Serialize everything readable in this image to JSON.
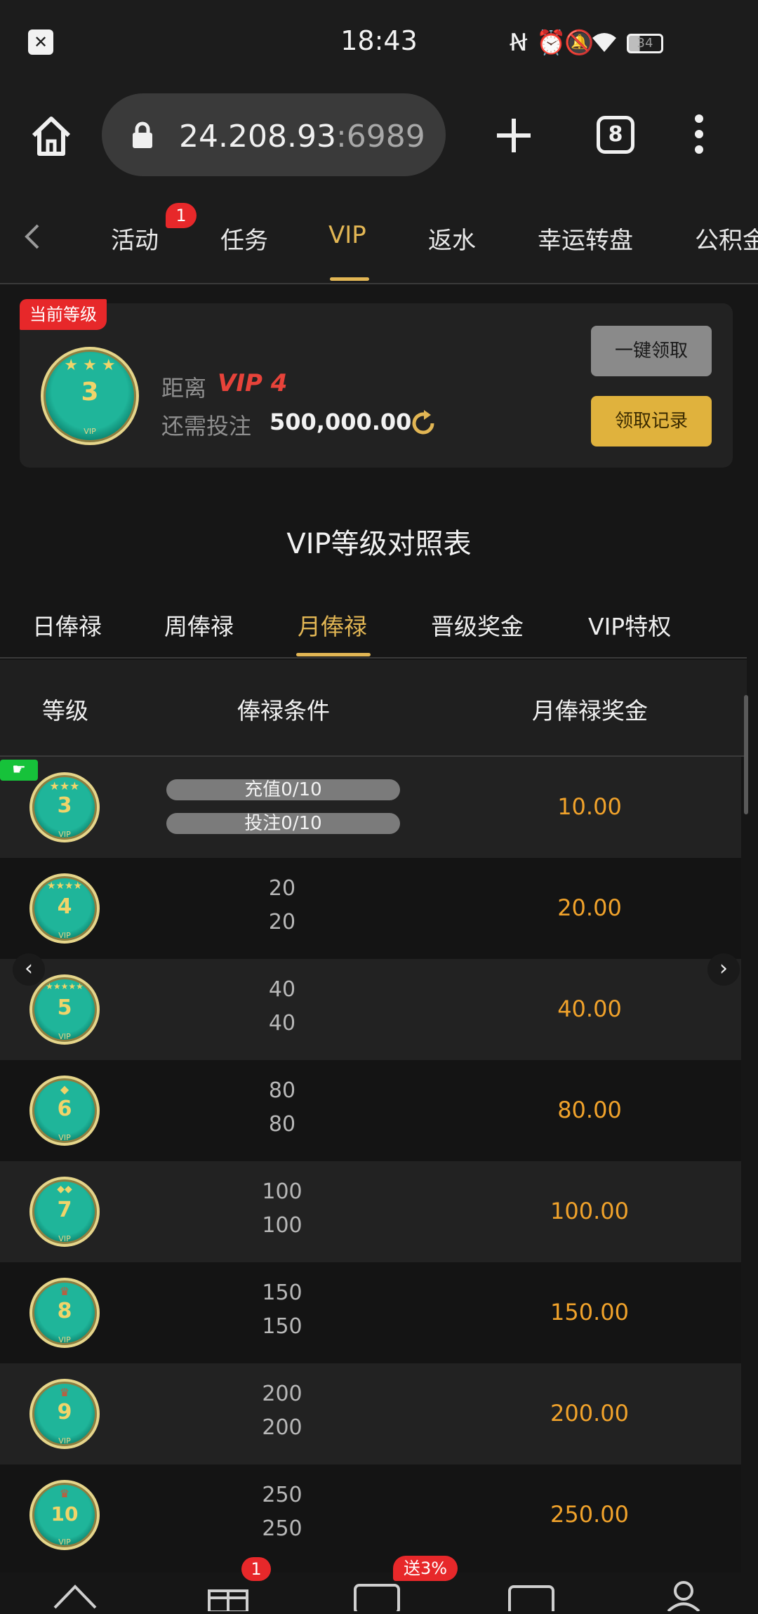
{
  "status_bar": {
    "time": "18:43",
    "battery": "34",
    "icons": [
      "notification-icon",
      "nfc-icon",
      "alarm-icon",
      "mute-icon",
      "wifi-icon",
      "battery-icon"
    ]
  },
  "browser": {
    "url_main": "24.208.93",
    "url_port": ":6989",
    "tab_count": "8"
  },
  "nav_tabs": [
    {
      "label": "活动"
    },
    {
      "label": "任务"
    },
    {
      "label": "VIP"
    },
    {
      "label": "返水"
    },
    {
      "label": "幸运转盘"
    },
    {
      "label": "公积金"
    }
  ],
  "nav_badge": "1",
  "level_card": {
    "tag": "当前等级",
    "current_level": "3",
    "distance_label": "距离",
    "next_vip": "VIP 4",
    "bet_label": "还需投注",
    "bet_amount": "500,000.00",
    "claim_all_label": "一键领取",
    "claim_record_label": "领取记录"
  },
  "table_title": "VIP等级对照表",
  "sub_tabs": [
    {
      "label": "日俸禄"
    },
    {
      "label": "周俸禄"
    },
    {
      "label": "月俸禄"
    },
    {
      "label": "晋级奖金"
    },
    {
      "label": "VIP特权"
    }
  ],
  "table": {
    "headers": {
      "level": "等级",
      "condition": "俸禄条件",
      "bonus": "月俸禄奖金"
    },
    "rows": [
      {
        "level": "3",
        "cond1": "充值0/10",
        "cond2": "投注0/10",
        "bonus": "10.00"
      },
      {
        "level": "4",
        "cond1": "20",
        "cond2": "20",
        "bonus": "20.00"
      },
      {
        "level": "5",
        "cond1": "40",
        "cond2": "40",
        "bonus": "40.00"
      },
      {
        "level": "6",
        "cond1": "80",
        "cond2": "80",
        "bonus": "80.00"
      },
      {
        "level": "7",
        "cond1": "100",
        "cond2": "100",
        "bonus": "100.00"
      },
      {
        "level": "8",
        "cond1": "150",
        "cond2": "150",
        "bonus": "150.00"
      },
      {
        "level": "9",
        "cond1": "200",
        "cond2": "200",
        "bonus": "200.00"
      },
      {
        "level": "10",
        "cond1": "250",
        "cond2": "250",
        "bonus": "250.00"
      }
    ]
  },
  "bottom_nav": {
    "gift_badge": "1",
    "wallet_badge": "送3%"
  },
  "colors": {
    "accent": "#e2b654",
    "badge": "#e7282a",
    "bonus": "#f0a22b",
    "next_vip": "#e7433a"
  }
}
